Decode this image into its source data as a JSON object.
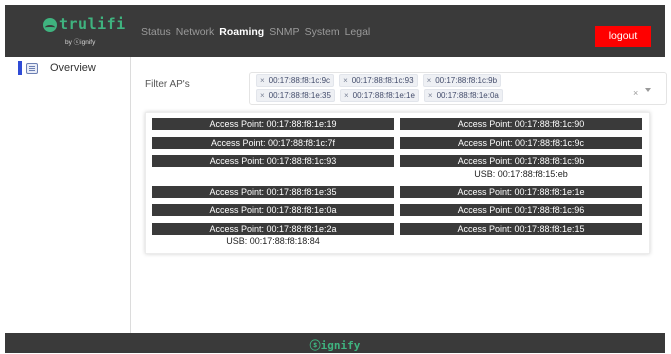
{
  "header": {
    "brand": "trulifi",
    "brand_sub": "by ⓢignify",
    "nav": [
      "Status",
      "Network",
      "Roaming",
      "SNMP",
      "System",
      "Legal"
    ],
    "active_nav": "Roaming",
    "logout_label": "logout"
  },
  "sidebar": {
    "items": [
      {
        "label": "Overview",
        "icon": "overview-icon"
      }
    ]
  },
  "filter": {
    "label": "Filter AP's",
    "tags": [
      "00:17:88:f8:1c:9c",
      "00:17:88:f8:1c:93",
      "00:17:88:f8:1c:9b",
      "00:17:88:f8:1e:35",
      "00:17:88:f8:1e:1e",
      "00:17:88:f8:1e:0a"
    ],
    "remove_glyph": "×",
    "clear_glyph": "×"
  },
  "access_points": {
    "left": [
      {
        "label": "Access Point: 00:17:88:f8:1e:19"
      },
      {
        "label": "Access Point: 00:17:88:f8:1c:7f"
      },
      {
        "label": "Access Point: 00:17:88:f8:1c:93"
      },
      {
        "label": "Access Point: 00:17:88:f8:1e:35"
      },
      {
        "label": "Access Point: 00:17:88:f8:1e:0a"
      },
      {
        "label": "Access Point: 00:17:88:f8:1e:2a",
        "usb": "USB: 00:17:88:f8:18:84"
      }
    ],
    "right": [
      {
        "label": "Access Point: 00:17:88:f8:1c:90"
      },
      {
        "label": "Access Point: 00:17:88:f8:1c:9c"
      },
      {
        "label": "Access Point: 00:17:88:f8:1c:9b",
        "usb": "USB: 00:17:88:f8:15:eb"
      },
      {
        "label": "Access Point: 00:17:88:f8:1e:1e"
      },
      {
        "label": "Access Point: 00:17:88:f8:1c:96"
      },
      {
        "label": "Access Point: 00:17:88:f8:1e:15"
      }
    ]
  },
  "footer": {
    "brand": "ⓢignify"
  },
  "colors": {
    "header_bg": "#3a3a3a",
    "brand_green": "#3fb37f",
    "logout_red": "#ff0000",
    "sidebar_accent": "#2f4bd6"
  }
}
